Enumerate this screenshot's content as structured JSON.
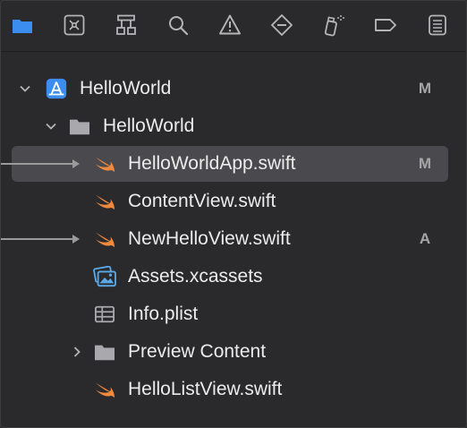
{
  "toolbar": {
    "tabs": [
      {
        "name": "project-navigator",
        "icon": "folder-icon",
        "active": true
      },
      {
        "name": "source-control-navigator",
        "icon": "source-control-icon"
      },
      {
        "name": "symbol-navigator",
        "icon": "hierarchy-icon"
      },
      {
        "name": "find-navigator",
        "icon": "search-icon"
      },
      {
        "name": "issue-navigator",
        "icon": "warning-icon"
      },
      {
        "name": "test-navigator",
        "icon": "test-diamond-icon"
      },
      {
        "name": "debug-navigator",
        "icon": "spray-can-icon"
      },
      {
        "name": "breakpoint-navigator",
        "icon": "breakpoint-icon"
      },
      {
        "name": "report-navigator",
        "icon": "report-icon"
      }
    ],
    "active_color": "#3b8ef0",
    "icon_color": "#b5b5b8"
  },
  "tree": [
    {
      "label": "HelloWorld",
      "type": "project",
      "status": "M",
      "expanded": true
    },
    {
      "label": "HelloWorld",
      "type": "folder",
      "status": "",
      "expanded": true
    },
    {
      "label": "HelloWorldApp.swift",
      "type": "swift",
      "status": "M",
      "selected": true,
      "pointer": true
    },
    {
      "label": "ContentView.swift",
      "type": "swift",
      "status": ""
    },
    {
      "label": "NewHelloView.swift",
      "type": "swift",
      "status": "A",
      "pointer": true
    },
    {
      "label": "Assets.xcassets",
      "type": "assets",
      "status": ""
    },
    {
      "label": "Info.plist",
      "type": "plist",
      "status": ""
    },
    {
      "label": "Preview Content",
      "type": "folder",
      "status": "",
      "expanded": false
    },
    {
      "label": "HelloListView.swift",
      "type": "swift",
      "status": ""
    }
  ],
  "colors": {
    "swift": "#f0883e",
    "folder": "#a9a9ad",
    "assets": "#5aa9e6",
    "plist": "#a9a9ad",
    "project": "#3b8ef0",
    "selection": "#4a4a4e"
  }
}
